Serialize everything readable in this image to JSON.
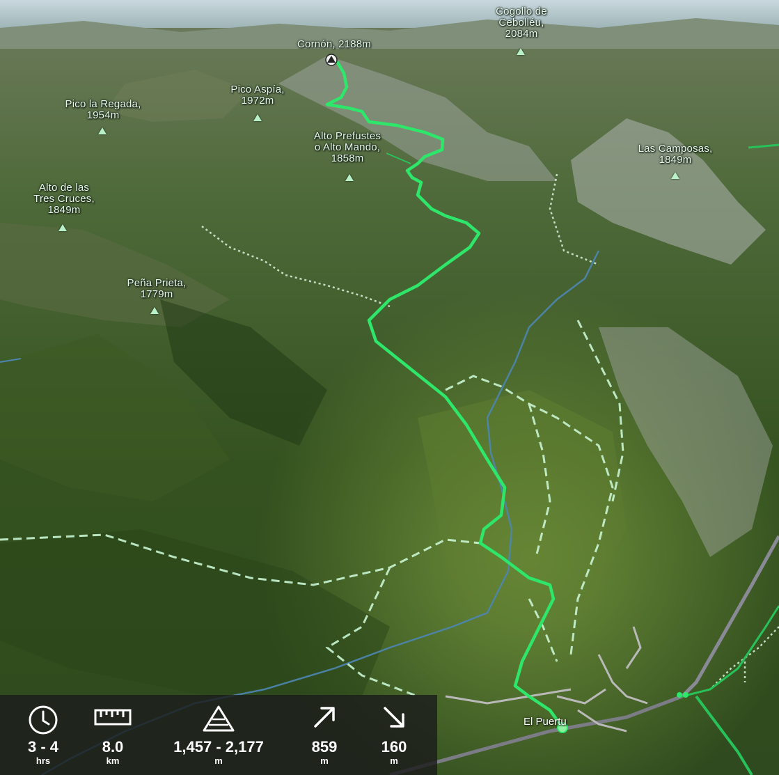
{
  "map": {
    "peaks": [
      {
        "id": "cogollo",
        "name": "Cogollo de\nCebolléu,",
        "elev": "2084m"
      },
      {
        "id": "cornon",
        "name": "Cornón, 2188m",
        "elev": ""
      },
      {
        "id": "aspia",
        "name": "Pico Aspía,",
        "elev": "1972m"
      },
      {
        "id": "regada",
        "name": "Pico la Regada,",
        "elev": "1954m"
      },
      {
        "id": "prefustes",
        "name": "Alto Prefustes\no Alto Mando,",
        "elev": "1858m"
      },
      {
        "id": "camposas",
        "name": "Las Camposas,",
        "elev": "1849m"
      },
      {
        "id": "trescruces",
        "name": "Alto de las\nTres Cruces,",
        "elev": "1849m"
      },
      {
        "id": "prieta",
        "name": "Peña Prieta,",
        "elev": "1779m"
      }
    ],
    "town": "El Puertu",
    "colors": {
      "route": "#2ee66a",
      "trail": "#c9f5d3",
      "river": "#4d86b3",
      "road": "#b9b9b9"
    }
  },
  "stats": {
    "duration": {
      "icon": "clock-icon",
      "value": "3 - 4",
      "unit": "hrs"
    },
    "distance": {
      "icon": "ruler-icon",
      "value": "8.0",
      "unit": "km"
    },
    "elevation_range": {
      "icon": "elevation-icon",
      "value": "1,457 - 2,177",
      "unit": "m"
    },
    "ascent": {
      "icon": "arrow-up-right-icon",
      "value": "859",
      "unit": "m"
    },
    "descent": {
      "icon": "arrow-down-right-icon",
      "value": "160",
      "unit": "m"
    }
  }
}
